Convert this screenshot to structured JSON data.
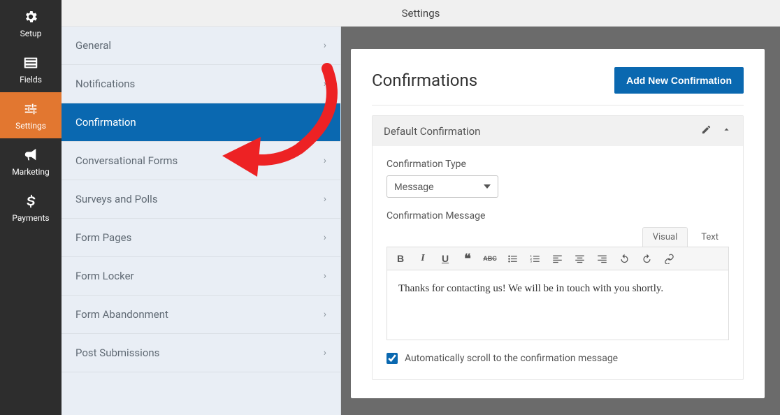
{
  "topbar": {
    "title": "Settings"
  },
  "sidebar": {
    "items": [
      {
        "label": "Setup",
        "icon": "gear-icon"
      },
      {
        "label": "Fields",
        "icon": "list-icon"
      },
      {
        "label": "Settings",
        "icon": "sliders-icon",
        "active": true
      },
      {
        "label": "Marketing",
        "icon": "bullhorn-icon"
      },
      {
        "label": "Payments",
        "icon": "dollar-icon"
      }
    ]
  },
  "subnav": {
    "items": [
      {
        "label": "General"
      },
      {
        "label": "Notifications"
      },
      {
        "label": "Confirmation",
        "active": true,
        "expanded": true
      },
      {
        "label": "Conversational Forms"
      },
      {
        "label": "Surveys and Polls"
      },
      {
        "label": "Form Pages"
      },
      {
        "label": "Form Locker"
      },
      {
        "label": "Form Abandonment"
      },
      {
        "label": "Post Submissions"
      }
    ]
  },
  "panel": {
    "title": "Confirmations",
    "add_button": "Add New Confirmation",
    "card": {
      "title": "Default Confirmation",
      "type_label": "Confirmation Type",
      "type_value": "Message",
      "message_label": "Confirmation Message",
      "editor_tabs": {
        "visual": "Visual",
        "text": "Text"
      },
      "editor_content": "Thanks for contacting us! We will be in touch with you shortly.",
      "scroll_checkbox_label": "Automatically scroll to the confirmation message",
      "scroll_checked": true
    }
  }
}
